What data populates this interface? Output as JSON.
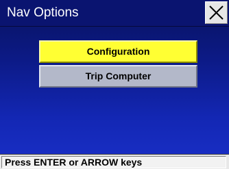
{
  "window": {
    "title": "Nav Options",
    "close_icon": "close-icon"
  },
  "menu": {
    "items": [
      {
        "label": "Configuration",
        "selected": true
      },
      {
        "label": "Trip Computer",
        "selected": false
      }
    ]
  },
  "status_bar": {
    "text": "Press ENTER or ARROW keys"
  },
  "colors": {
    "background": "#0c1a86",
    "title_bar": "#0a1470",
    "selected_item": "#ffff33",
    "normal_item": "#b3b8c9",
    "status_bar": "#e8e8e8"
  }
}
